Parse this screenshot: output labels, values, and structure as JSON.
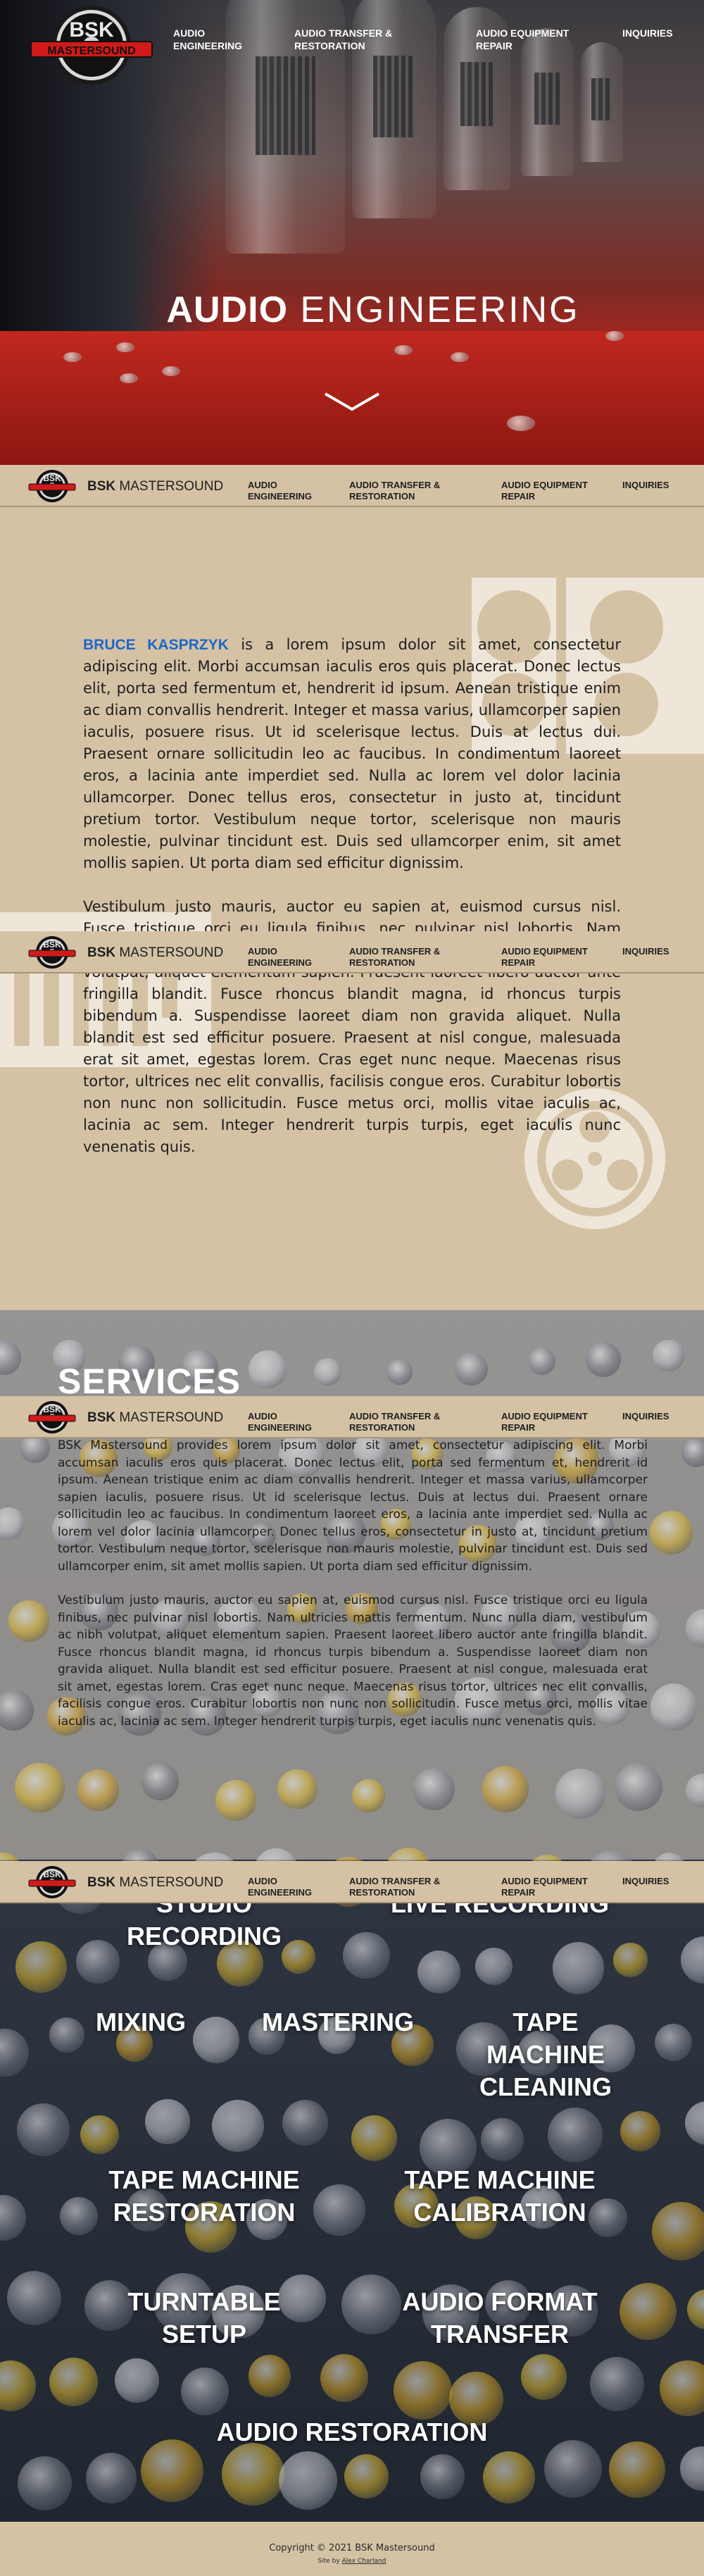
{
  "brand": {
    "logo_text": "BSK",
    "logo_banner": "MASTERSOUND",
    "name_bold": "BSK",
    "name_rest": " MASTERSOUND"
  },
  "nav": {
    "items": [
      {
        "line1": "AUDIO",
        "line2": "ENGINEERING"
      },
      {
        "line1": "AUDIO TRANSFER &",
        "line2": "RESTORATION"
      },
      {
        "line1": "AUDIO EQUIPMENT",
        "line2": "REPAIR"
      },
      {
        "line1": "INQUIRIES",
        "line2": ""
      }
    ]
  },
  "hero": {
    "title_bold": "AUDIO",
    "title_light": " ENGINEERING",
    "scroll_icon": "chevron-down-icon"
  },
  "about": {
    "name": "BRUCE KASPRZYK",
    "paragraph1": " is a lorem ipsum dolor sit amet, consectetur adipiscing elit. Morbi accumsan iaculis eros quis placerat. Donec lectus elit, porta sed fermentum et, hendrerit id ipsum. Aenean tristique enim ac diam convallis hendrerit. Integer et massa varius, ullamcorper sapien iaculis, posuere risus. Ut id scelerisque lectus. Duis at lectus dui. Praesent ornare sollicitudin leo ac faucibus. In condimentum laoreet eros, a lacinia ante imperdiet sed. Nulla ac lorem vel dolor lacinia ullamcorper. Donec tellus eros, consectetur in justo at, tincidunt pretium tortor. Vestibulum neque tortor, scelerisque non mauris molestie, pulvinar tincidunt est. Duis sed ullamcorper enim, sit amet mollis sapien. Ut porta diam sed efficitur dignissim.",
    "paragraph2": "Vestibulum justo mauris, auctor eu sapien at, euismod cursus nisl. Fusce tristique orci eu ligula finibus, nec pulvinar nisl lobortis. Nam ultricies mattis fermentum. Nunc nulla diam, vestibulum ac nibh volutpat, aliquet elementum sapien. Praesent laoreet libero auctor ante fringilla blandit. Fusce rhoncus blandit magna, id rhoncus turpis bibendum a. Suspendisse laoreet diam non gravida aliquet. Nulla blandit est sed efficitur posuere. Praesent at nisl congue, malesuada erat sit amet, egestas lorem. Cras eget nunc neque. Maecenas risus tortor, ultrices nec elit convallis, facilisis congue eros. Curabitur lobortis non nunc non sollicitudin. Fusce metus orci, mollis vitae iaculis ac, lacinia ac sem. Integer hendrerit turpis turpis, eget iaculis nunc venenatis quis."
  },
  "services": {
    "heading": "SERVICES",
    "paragraph1": "BSK Mastersound provides lorem ipsum dolor sit amet, consectetur adipiscing elit. Morbi accumsan iaculis eros quis placerat. Donec lectus elit, porta sed fermentum et, hendrerit id ipsum. Aenean tristique enim ac diam convallis hendrerit. Integer et massa varius, ullamcorper sapien iaculis, posuere risus. Ut id scelerisque lectus. Duis at lectus dui. Praesent ornare sollicitudin leo ac faucibus. In condimentum laoreet eros, a lacinia ante imperdiet sed. Nulla ac lorem vel dolor lacinia ullamcorper. Donec tellus eros, consectetur in justo at, tincidunt pretium tortor. Vestibulum neque tortor, scelerisque non mauris molestie, pulvinar tincidunt est. Duis sed ullamcorper enim, sit amet mollis sapien. Ut porta diam sed efficitur dignissim.",
    "paragraph2": "Vestibulum justo mauris, auctor eu sapien at, euismod cursus nisl. Fusce tristique orci eu ligula finibus, nec pulvinar nisl lobortis. Nam ultricies mattis fermentum. Nunc nulla diam, vestibulum ac nibh volutpat, aliquet elementum sapien. Praesent laoreet libero auctor ante fringilla blandit. Fusce rhoncus blandit magna, id rhoncus turpis bibendum a. Suspendisse laoreet diam non gravida aliquet. Nulla blandit est sed efficitur posuere. Praesent at nisl congue, malesuada erat sit amet, egestas lorem. Cras eget nunc neque. Maecenas risus tortor, ultrices nec elit convallis, facilisis congue eros. Curabitur lobortis non nunc non sollicitudin. Fusce metus orci, mollis vitae iaculis ac, lacinia ac sem. Integer hendrerit turpis turpis, eget iaculis nunc venenatis quis.",
    "items": [
      {
        "line1": "STUDIO",
        "line2": "RECORDING",
        "line3": ""
      },
      {
        "line1": "LIVE RECORDING",
        "line2": "",
        "line3": ""
      },
      {
        "line1": "MIXING",
        "line2": "",
        "line3": ""
      },
      {
        "line1": "MASTERING",
        "line2": "",
        "line3": ""
      },
      {
        "line1": "TAPE",
        "line2": "MACHINE",
        "line3": "CLEANING"
      },
      {
        "line1": "TAPE MACHINE",
        "line2": "RESTORATION",
        "line3": ""
      },
      {
        "line1": "TAPE MACHINE",
        "line2": "CALIBRATION",
        "line3": ""
      },
      {
        "line1": "TURNTABLE",
        "line2": "SETUP",
        "line3": ""
      },
      {
        "line1": "AUDIO FORMAT",
        "line2": "TRANSFER",
        "line3": ""
      },
      {
        "line1": "AUDIO RESTORATION",
        "line2": "",
        "line3": ""
      }
    ]
  },
  "footer": {
    "copyright": "Copyright © 2021 BSK Mastersound",
    "credit_prefix": "Site by ",
    "credit_link": "Alex Charland"
  },
  "colors": {
    "tan": "#d5c2a5",
    "accent_blue": "#1f67c8",
    "logo_red": "#d11a1a"
  }
}
